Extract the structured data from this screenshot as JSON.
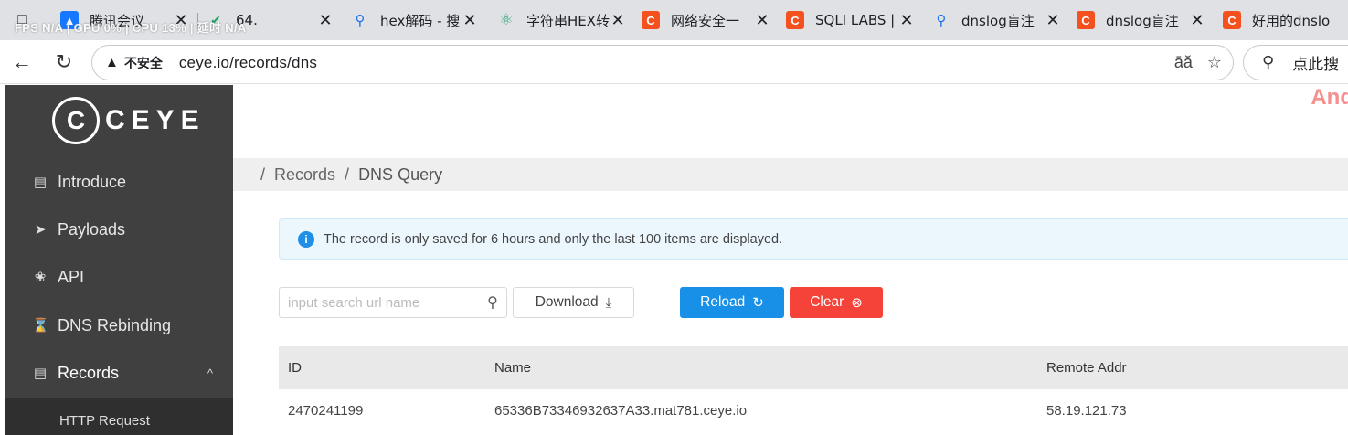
{
  "browser": {
    "overlay_stats": "FPS N/A | GPU 0% | CPU 13% | 延时 N/A",
    "tabs": [
      {
        "title": "腾讯会议",
        "icon": "tencent-meeting-icon"
      },
      {
        "title": "64.",
        "icon": "green-check-icon"
      },
      {
        "title": "hex解码 - 搜",
        "icon": "search-icon"
      },
      {
        "title": "字符串HEX转",
        "icon": "react-icon"
      },
      {
        "title": "网络安全一",
        "icon": "csdn-icon"
      },
      {
        "title": "SQLI LABS | ",
        "icon": "csdn-icon"
      },
      {
        "title": "dnslog盲注",
        "icon": "search-icon"
      },
      {
        "title": "dnslog盲注",
        "icon": "csdn-icon"
      },
      {
        "title": "好用的dnslo",
        "icon": "csdn-icon"
      }
    ],
    "security_label": "不安全",
    "url": "ceye.io/records/dns",
    "search_text": "点此搜"
  },
  "sidebar": {
    "logo_letter": "C",
    "logo_text": "CEYE",
    "items": [
      {
        "label": "Introduce",
        "icon": "book-icon"
      },
      {
        "label": "Payloads",
        "icon": "rocket-icon"
      },
      {
        "label": "API",
        "icon": "api-icon"
      },
      {
        "label": "DNS Rebinding",
        "icon": "hourglass-icon"
      },
      {
        "label": "Records",
        "icon": "records-icon"
      }
    ],
    "sub_item": "HTTP Request"
  },
  "corner_text": "And",
  "breadcrumb": {
    "first": "Records",
    "sep": "/",
    "current": "DNS Query"
  },
  "alert": {
    "text": "The record is only saved for 6 hours and only the last 100 items are displayed."
  },
  "search": {
    "placeholder": "input search url name",
    "value": ""
  },
  "buttons": {
    "download": "Download",
    "reload": "Reload",
    "clear": "Clear"
  },
  "table": {
    "headers": [
      "ID",
      "Name",
      "Remote Addr"
    ],
    "rows": [
      {
        "id": "2470241199",
        "name": "65336B73346932637A33.mat781.ceye.io",
        "remote": "58.19.121.73"
      }
    ]
  }
}
